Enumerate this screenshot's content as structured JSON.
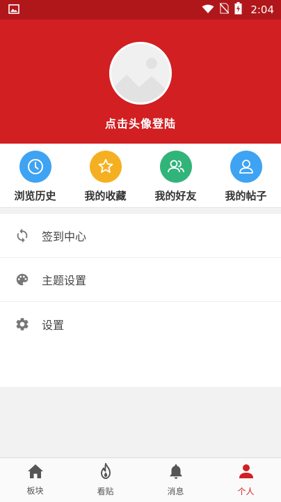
{
  "status_bar": {
    "time": "2:04",
    "bg_color": "#b0171b",
    "icons": [
      "image-icon",
      "wifi-icon",
      "no-sim-icon",
      "battery-charging-icon"
    ]
  },
  "header": {
    "bg_color": "#d21f22",
    "avatar_icon": "placeholder-image-icon",
    "login_text": "点击头像登陆"
  },
  "quick_actions": [
    {
      "label": "浏览历史",
      "icon": "clock-icon",
      "color": "#3ea3f2"
    },
    {
      "label": "我的收藏",
      "icon": "star-icon",
      "color": "#f5b021"
    },
    {
      "label": "我的好友",
      "icon": "friends-icon",
      "color": "#31b47a"
    },
    {
      "label": "我的帖子",
      "icon": "user-icon",
      "color": "#3ea3f2"
    }
  ],
  "menu": [
    {
      "label": "签到中心",
      "icon": "refresh-icon"
    },
    {
      "label": "主题设置",
      "icon": "palette-icon"
    },
    {
      "label": "设置",
      "icon": "gear-icon"
    }
  ],
  "bottom_nav": {
    "active_color": "#d21f22",
    "items": [
      {
        "label": "板块",
        "icon": "home-icon",
        "active": false
      },
      {
        "label": "看贴",
        "icon": "flame-icon",
        "active": false
      },
      {
        "label": "消息",
        "icon": "bell-icon",
        "active": false
      },
      {
        "label": "个人",
        "icon": "person-icon",
        "active": true
      }
    ]
  }
}
